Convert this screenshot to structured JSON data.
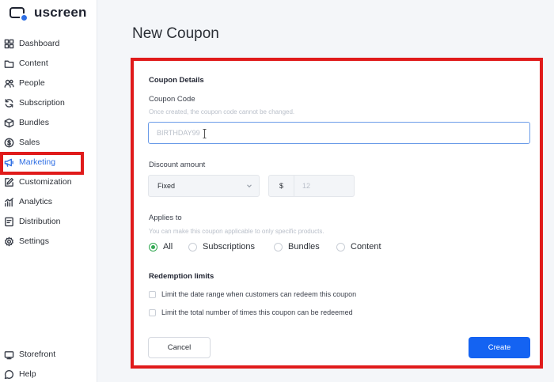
{
  "app": {
    "logo_text": "uscreen"
  },
  "sidebar": {
    "items": [
      {
        "label": "Dashboard",
        "icon": "dashboard-icon"
      },
      {
        "label": "Content",
        "icon": "folder-icon"
      },
      {
        "label": "People",
        "icon": "people-icon"
      },
      {
        "label": "Subscription",
        "icon": "refresh-icon"
      },
      {
        "label": "Bundles",
        "icon": "box-icon"
      },
      {
        "label": "Sales",
        "icon": "dollar-icon"
      },
      {
        "label": "Marketing",
        "icon": "megaphone-icon",
        "active": true
      },
      {
        "label": "Customization",
        "icon": "edit-icon"
      },
      {
        "label": "Analytics",
        "icon": "chart-icon"
      },
      {
        "label": "Distribution",
        "icon": "distribution-icon"
      },
      {
        "label": "Settings",
        "icon": "gear-icon"
      }
    ],
    "bottom": [
      {
        "label": "Storefront",
        "icon": "storefront-icon"
      },
      {
        "label": "Help",
        "icon": "help-icon"
      }
    ]
  },
  "page": {
    "title": "New Coupon"
  },
  "form": {
    "section_title": "Coupon Details",
    "code_label": "Coupon Code",
    "code_hint": "Once created, the coupon code cannot be changed.",
    "code_placeholder": "BIRTHDAY99",
    "discount_label": "Discount amount",
    "discount_type": "Fixed",
    "currency_symbol": "$",
    "amount_placeholder": "12",
    "applies_label": "Applies to",
    "applies_hint": "You can make this coupon applicable to only specific products.",
    "applies_options": [
      {
        "label": "All",
        "checked": true
      },
      {
        "label": "Subscriptions",
        "checked": false
      },
      {
        "label": "Bundles",
        "checked": false
      },
      {
        "label": "Content",
        "checked": false
      }
    ],
    "limits_title": "Redemption limits",
    "limits": [
      {
        "label": "Limit the date range when customers can redeem this coupon"
      },
      {
        "label": "Limit the total number of times this coupon can be redeemed"
      }
    ],
    "cancel_label": "Cancel",
    "create_label": "Create"
  },
  "colors": {
    "accent": "#1463f2",
    "highlight": "#e01b1b",
    "selected": "#33a853"
  }
}
